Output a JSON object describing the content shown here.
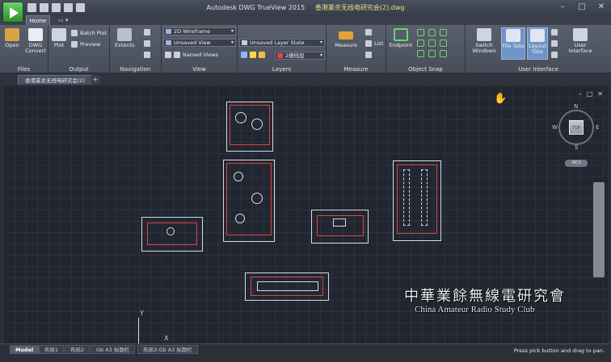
{
  "window": {
    "title_app": "Autodesk DWG TrueView 2015",
    "title_doc": "香港業余无线电研究会(2).dwg",
    "controls": [
      "–",
      "□",
      "✕"
    ]
  },
  "ribbon": {
    "tabs": [
      "Home"
    ],
    "groups": {
      "files": {
        "label": "Files",
        "open": "Open",
        "dwg_convert": "DWG Convert"
      },
      "output": {
        "label": "Output",
        "plot": "Plot",
        "batch_plot": "Batch Plot",
        "preview": "Preview"
      },
      "navigation": {
        "label": "Navigation",
        "extents": "Extents"
      },
      "view": {
        "label": "View",
        "visual_style": "2D Wireframe",
        "saved_view": "Unsaved View",
        "named_views": "Named Views"
      },
      "layers": {
        "label": "Layers",
        "layer_state": "Unsaved Layer State",
        "current_layer": "2细线层"
      },
      "measure": {
        "label": "Measure",
        "measure": "Measure",
        "list": "List"
      },
      "object_snap": {
        "label": "Object Snap",
        "endpoint": "Endpoint"
      },
      "user_interface": {
        "label": "User Interface",
        "switch_windows": "Switch Windows",
        "file_tabs": "File Tabs",
        "layout_tabs": "Layout Tabs",
        "user_interface": "User Interface"
      }
    }
  },
  "document_tab": {
    "label": "香港業余无线电研究会(2)",
    "close": "✕",
    "new": "+"
  },
  "viewport": {
    "controls": [
      "–",
      "□",
      "✕"
    ]
  },
  "viewcube": {
    "top": "TOP",
    "north": "N",
    "south": "S",
    "east": "E",
    "west": "W",
    "wcs": "WCS"
  },
  "ucs": {
    "y": "Y",
    "x": "X"
  },
  "watermark": {
    "chinese": "中華業餘無線電研究會",
    "english": "China Amateur Radio Study Club"
  },
  "layout_tabs": [
    "Model",
    "布局1",
    "布局2",
    "Gb A3 标题栏",
    "布局3-Gb A3 标题栏"
  ],
  "status": {
    "prompt": "Press pick button and drag to pan."
  },
  "colors": {
    "canvas": "#212630",
    "ribbon": "#4f5563",
    "accent": "#5e8bd0",
    "drawing_red": "#e24444"
  }
}
